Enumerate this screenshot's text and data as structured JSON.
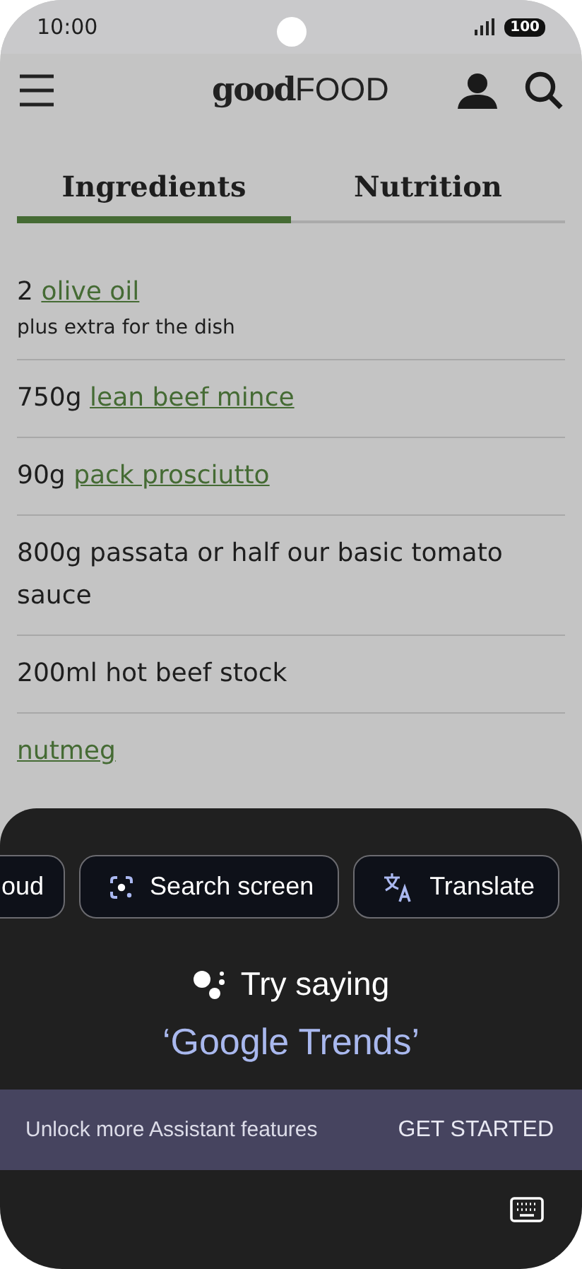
{
  "status_bar": {
    "time": "10:00",
    "battery": "100"
  },
  "header": {
    "logo": "**good**FOOD"
  },
  "tabs": [
    {
      "label": "Ingredients",
      "selected": true
    },
    {
      "label": "Nutrition",
      "selected": false
    }
  ],
  "ingredients": [
    {
      "quantity": "2",
      "name": "olive oil",
      "linked": true,
      "note": "plus extra for the dish"
    },
    {
      "quantity": "750g",
      "name": "lean beef mince",
      "linked": true
    },
    {
      "quantity": "90g",
      "name": "pack prosciutto",
      "linked": true
    },
    {
      "quantity": "800g",
      "name": "passata or half our basic tomato sauce",
      "linked": false
    },
    {
      "quantity": "200ml",
      "name": "hot beef stock",
      "linked": false
    },
    {
      "name": "nutmeg",
      "linked": true
    }
  ],
  "assistant": {
    "chips": [
      {
        "label": "oud",
        "kind": "cut"
      },
      {
        "label": "Search screen",
        "kind": "lens"
      },
      {
        "label": "Translate",
        "kind": "translate"
      }
    ],
    "prompt": "Try saying",
    "suggestion": "‘Google Trends’",
    "banner": {
      "text": "Unlock more Assistant features",
      "action": "GET STARTED"
    }
  }
}
